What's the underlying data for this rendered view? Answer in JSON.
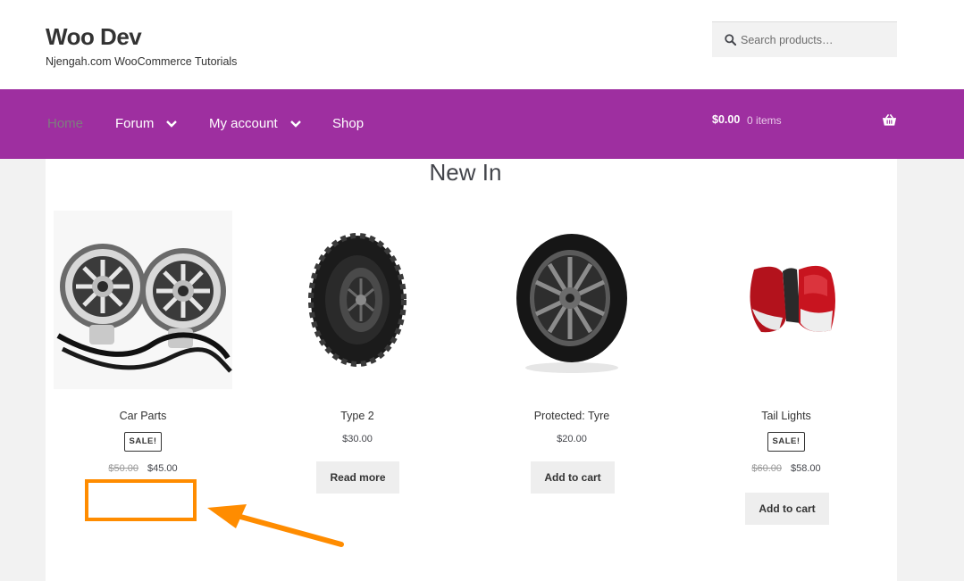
{
  "site": {
    "title": "Woo Dev",
    "tagline": "Njengah.com WooCommerce Tutorials"
  },
  "search": {
    "placeholder": "Search products…",
    "icon": "search-icon"
  },
  "nav": {
    "items": [
      {
        "label": "Home",
        "current": true,
        "dropdown": false
      },
      {
        "label": "Forum",
        "current": false,
        "dropdown": true
      },
      {
        "label": "My account",
        "current": false,
        "dropdown": true
      },
      {
        "label": "Shop",
        "current": false,
        "dropdown": false
      }
    ],
    "cart": {
      "total": "$0.00",
      "count": "0 items",
      "icon": "basket-icon"
    }
  },
  "section": {
    "title": "New In"
  },
  "products": [
    {
      "name": "Car Parts",
      "sale_badge": "SALE!",
      "regular_price": "$50.00",
      "price": "$45.00",
      "button": ""
    },
    {
      "name": "Type 2",
      "sale_badge": "",
      "regular_price": "",
      "price": "$30.00",
      "button": "Read more"
    },
    {
      "name": "Protected: Tyre",
      "sale_badge": "",
      "regular_price": "",
      "price": "$20.00",
      "button": "Add to cart"
    },
    {
      "name": "Tail Lights",
      "sale_badge": "SALE!",
      "regular_price": "$60.00",
      "price": "$58.00",
      "button": "Add to cart"
    }
  ],
  "colors": {
    "navbar": "#9e2fa0",
    "annotation": "#ff8c00"
  }
}
